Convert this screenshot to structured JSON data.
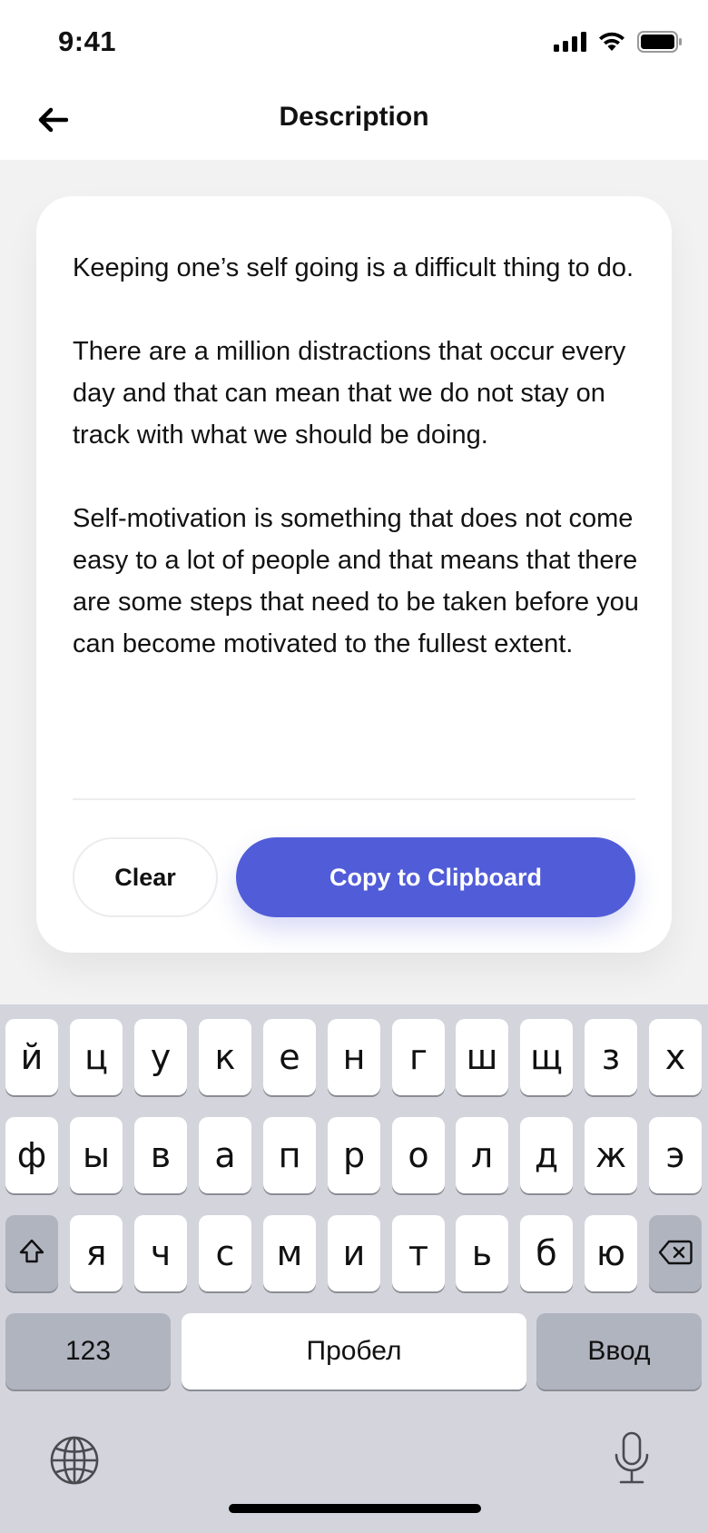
{
  "status_bar": {
    "time": "9:41",
    "icons": [
      "cellular-signal-icon",
      "wifi-icon",
      "battery-icon"
    ]
  },
  "nav": {
    "title": "Description",
    "back_icon": "arrow-left-icon"
  },
  "card": {
    "paragraphs": [
      "Keeping one’s self going is a difficult thing to do.",
      "There are a million distractions that occur every day and that can mean that we do not stay on track with what we should be doing.",
      "Self-motivation is something that does not come easy to a lot of people and that means that there are some steps that need to be taken before you can become motivated to the fullest extent."
    ],
    "clear_label": "Clear",
    "copy_label": "Copy to Clipboard"
  },
  "colors": {
    "accent": "#515cd8",
    "background": "#f2f2f3",
    "keyboard": "#d3d4dc"
  },
  "keyboard": {
    "row1": [
      "й",
      "ц",
      "у",
      "к",
      "е",
      "н",
      "г",
      "ш",
      "щ",
      "з",
      "х"
    ],
    "row2": [
      "ф",
      "ы",
      "в",
      "а",
      "п",
      "р",
      "о",
      "л",
      "д",
      "ж",
      "э"
    ],
    "row3": [
      "я",
      "ч",
      "с",
      "м",
      "и",
      "т",
      "ь",
      "б",
      "ю"
    ],
    "shift_icon": "shift-icon",
    "delete_icon": "delete-backspace-icon",
    "numbers_label": "123",
    "space_label": "Пробел",
    "return_label": "Ввод",
    "globe_icon": "globe-icon",
    "mic_icon": "microphone-icon"
  }
}
